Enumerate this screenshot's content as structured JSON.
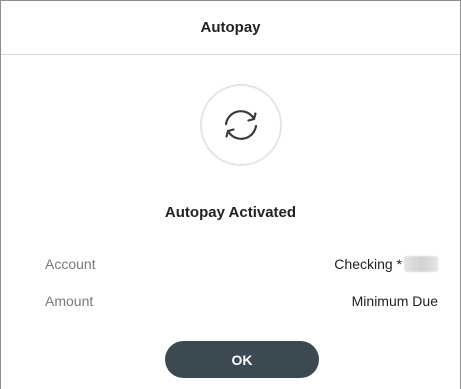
{
  "dialog": {
    "title": "Autopay",
    "status_icon": "refresh-cycle-icon",
    "status_title": "Autopay Activated",
    "rows": [
      {
        "label": "Account",
        "value": "Checking *"
      },
      {
        "label": "Amount",
        "value": "Minimum Due"
      }
    ],
    "ok_label": "OK"
  },
  "colors": {
    "button_background": "#3b4a52",
    "button_text": "#ffffff",
    "label_text": "#7a7a7a",
    "primary_text": "#222222",
    "divider": "#d7d7d7"
  }
}
